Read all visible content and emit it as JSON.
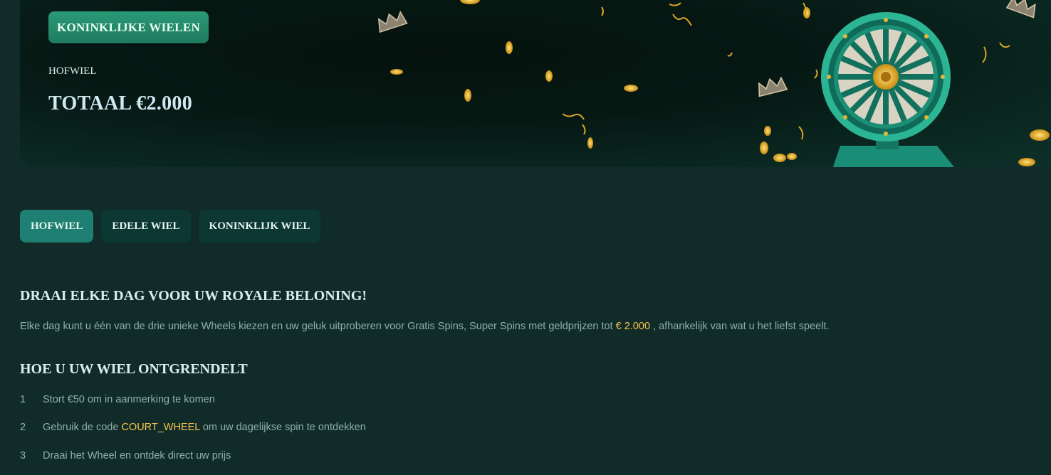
{
  "hero": {
    "badge": "KONINKLIJKE WIELEN",
    "subtitle": "HOFWIEL",
    "total": "TOTAAL €2.000",
    "colors": {
      "gold": "#f1bf2e",
      "wheel": "#17806a"
    }
  },
  "tabs": [
    {
      "label": "HOFWIEL",
      "active": true
    },
    {
      "label": "EDELE WIEL",
      "active": false
    },
    {
      "label": "KONINKLIJK WIEL",
      "active": false
    }
  ],
  "section1": {
    "title": "DRAAI ELKE DAG VOOR UW ROYALE BELONING!",
    "text_before": "Elke dag kunt u één van de drie unieke Wheels kiezen en uw geluk uitproberen voor Gratis Spins, Super Spins met geldprijzen tot",
    "highlight": "€ 2.000",
    "text_after": ", afhankelijk van wat u het liefst speelt."
  },
  "section2": {
    "title": "HOE U UW WIEL ONTGRENDELT",
    "steps": [
      {
        "num": "1",
        "before": "Stort €50 om in aanmerking te komen",
        "code": "",
        "after": ""
      },
      {
        "num": "2",
        "before": "Gebruik de code",
        "code": "COURT_WHEEL",
        "after": "om uw dagelijkse spin te ontdekken"
      },
      {
        "num": "3",
        "before": "Draai het Wheel en ontdek direct uw prijs",
        "code": "",
        "after": ""
      }
    ]
  }
}
